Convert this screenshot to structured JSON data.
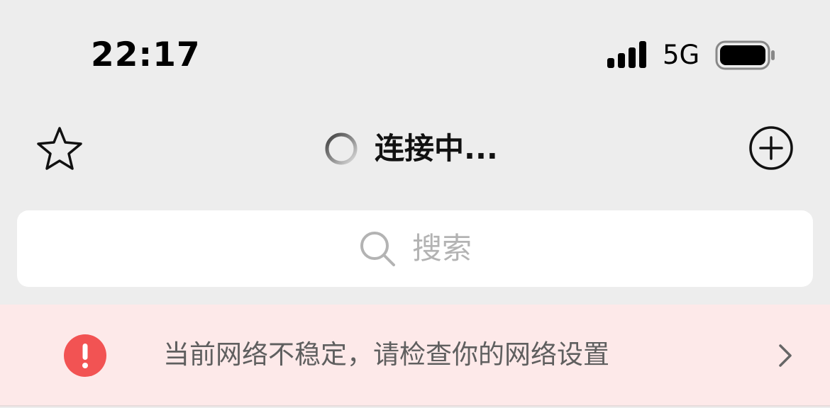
{
  "status_bar": {
    "time": "22:17",
    "network": "5G"
  },
  "nav": {
    "title": "连接中..."
  },
  "search": {
    "placeholder": "搜索"
  },
  "alert": {
    "message": "当前网络不稳定，请检查你的网络设置"
  },
  "colors": {
    "background": "#ededed",
    "alert_background": "#fde9e9",
    "alert_icon": "#f25353",
    "placeholder": "#b3b3b3"
  },
  "icons": {
    "favorite": "star-icon",
    "loading": "spinner-icon",
    "add": "plus-circle-icon",
    "search": "search-icon",
    "alert": "exclamation-circle-icon",
    "chevron": "chevron-right-icon",
    "signal": "signal-icon",
    "battery": "battery-icon"
  }
}
